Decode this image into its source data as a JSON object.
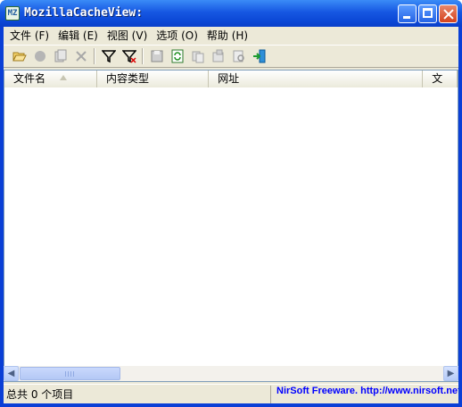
{
  "window": {
    "title": "MozillaCacheView:",
    "icon_label": "MZ"
  },
  "menu": {
    "items": [
      {
        "label": "文件 (F)"
      },
      {
        "label": "编辑 (E)"
      },
      {
        "label": "视图 (V)"
      },
      {
        "label": "选项 (O)"
      },
      {
        "label": "帮助 (H)"
      }
    ]
  },
  "toolbar": {
    "icons": [
      "open-folder-icon",
      "stop-icon",
      "copy-cache-icon",
      "delete-icon",
      "filter-icon",
      "clear-filter-icon",
      "save-icon",
      "refresh-icon",
      "copy-icon",
      "properties-icon",
      "find-icon",
      "exit-icon"
    ]
  },
  "list": {
    "columns": [
      "文件名",
      "内容类型",
      "网址",
      "文"
    ]
  },
  "status": {
    "count_text": "总共 0 个项目",
    "credit_text": "NirSoft Freeware.  http://www.nirsoft.net"
  },
  "colors": {
    "title_blue": "#0a3fd6",
    "credit_blue": "#0000ff",
    "face": "#ece9d8"
  }
}
